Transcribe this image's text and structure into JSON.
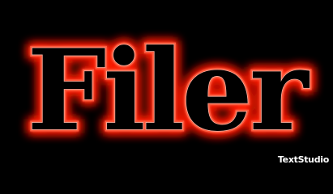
{
  "logo": {
    "text": "Filer",
    "glow_color": "#ff1a00",
    "stroke_color": "#ff5a3c",
    "inner_color": "#ffb0a0",
    "fill_color": "#000000"
  },
  "watermark": {
    "text": "TextStudio"
  }
}
